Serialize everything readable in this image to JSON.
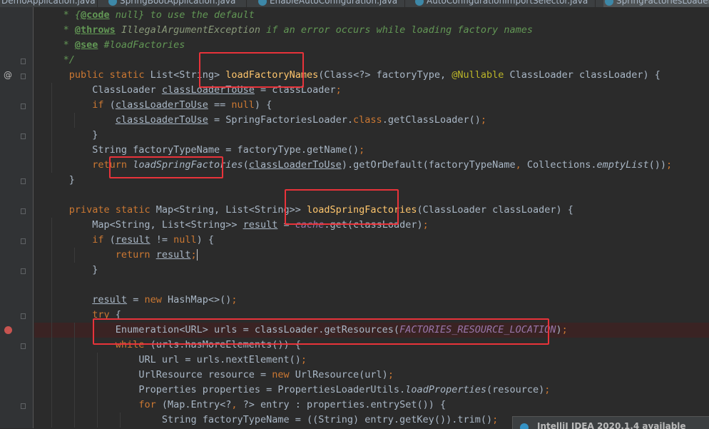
{
  "tabs": [
    {
      "label": "DemoApplication.java"
    },
    {
      "label": "SpringBootApplication.java"
    },
    {
      "label": "EnableAutoConfiguration.java"
    },
    {
      "label": "AutoConfigurationImportSelector.java"
    },
    {
      "label": "SpringFactoriesLoader",
      "active": true
    }
  ],
  "code": {
    "l1": {
      "p1": "     * {",
      "p2": "@code",
      "p3": " null} to use the default"
    },
    "l2": {
      "p1": "     * ",
      "p2": "@throws",
      "p3": " IllegalArgumentException",
      "p4": " if an error occurs while loading factory names"
    },
    "l3": {
      "p1": "     * ",
      "p2": "@see",
      "p3": " #loadFactories"
    },
    "l4": {
      "p1": "     */"
    },
    "l5": {
      "p1": "public static ",
      "p2": "List<String> ",
      "p3": "loadFactoryNames",
      "p4": "(Class<?> factoryType, ",
      "p5": "@Nullable",
      "p6": " ClassLoader classLoader) {"
    },
    "l6": {
      "p1": "ClassLoader ",
      "p2": "classLoaderToUse",
      "p3": " = classLoader",
      "p4": ";"
    },
    "l7": {
      "p1": "if ",
      "p2": "(",
      "p3": "classLoaderToUse",
      "p4": " == ",
      "p5": "null",
      "p6": ") {"
    },
    "l8": {
      "p1": "classLoaderToUse",
      "p2": " = SpringFactoriesLoader.",
      "p3": "class",
      "p4": ".getClassLoader()",
      "p5": ";"
    },
    "l9": {
      "p1": "}"
    },
    "l10": {
      "p1": "String factoryTypeName = factoryType.getName()",
      "p2": ";"
    },
    "l11": {
      "p1": "return ",
      "p2": "loadSpringFactories",
      "p3": "(",
      "p4": "classLoaderToUse",
      "p5": ").getOrDefault(factoryTypeName",
      "p6": ", ",
      "p7": "Collections.",
      "p8": "emptyList",
      "p9": "())",
      "p10": ";"
    },
    "l12": {
      "p1": "}"
    },
    "l13": {
      "p1": "private static ",
      "p2": "Map<String, List<String>> ",
      "p3": "loadSpringFactories",
      "p4": "(ClassLoader classLoader) {"
    },
    "l14": {
      "p1": "Map<String, List<String>> ",
      "p2": "result",
      "p3": " = ",
      "p4": "cache",
      "p5": ".get(classLoader)",
      "p6": ";"
    },
    "l15": {
      "p1": "if ",
      "p2": "(",
      "p3": "result",
      "p4": " != ",
      "p5": "null",
      "p6": ") {"
    },
    "l16": {
      "p1": "return ",
      "p2": "result",
      "p3": ";"
    },
    "l17": {
      "p1": "}"
    },
    "l18": {
      "p1": "result",
      "p2": " = ",
      "p3": "new ",
      "p4": "HashMap<>()",
      "p5": ";"
    },
    "l19": {
      "p1": "try ",
      "p2": "{"
    },
    "l20": {
      "p1": "Enumeration<URL> urls = classLoader.getResources(",
      "p2": "FACTORIES_RESOURCE_LOCATION",
      "p3": ")",
      "p4": ";"
    },
    "l21": {
      "p1": "while ",
      "p2": "(urls.hasMoreElements()) {"
    },
    "l22": {
      "p1": "URL url = urls.nextElement()",
      "p2": ";"
    },
    "l23": {
      "p1": "UrlResource resource = ",
      "p2": "new ",
      "p3": "UrlResource(url)",
      "p4": ";"
    },
    "l24": {
      "p1": "Properties properties = PropertiesLoaderUtils.",
      "p2": "loadProperties",
      "p3": "(resource)",
      "p4": ";"
    },
    "l25": {
      "p1": "for ",
      "p2": "(Map.Entry<?",
      "p3": ", ",
      "p4": "?> entry : properties.entrySet()) {"
    },
    "l26": {
      "p1": "String factoryTypeName = ((String) entry.getKey()).trim()",
      "p2": ";"
    }
  },
  "gutter": {
    "override_marker": "@"
  },
  "notification": {
    "text": "IntelliJ IDEA 2020.1.4 available"
  },
  "colors": {
    "highlight_box": "#e8333a",
    "breakpoint": "#c75450"
  }
}
